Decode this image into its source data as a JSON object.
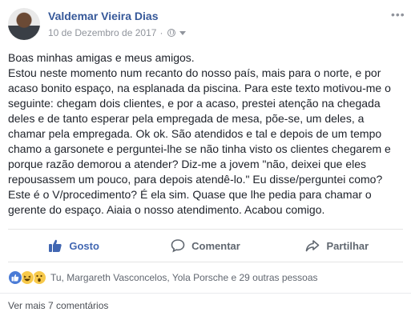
{
  "post": {
    "author": "Valdemar Vieira Dias",
    "date": "10 de Dezembro de 2017",
    "separator": "·",
    "more_icon": "ellipsis-icon",
    "privacy_icon": "globe-icon",
    "paragraphs": [
      "Boas minhas amigas e meus amigos.",
      "Estou neste momento num recanto do nosso país, mais para o norte, e por acaso bonito espaço, na esplanada da piscina. Para este texto motivou-me o seguinte: chegam dois clientes, e por a acaso, prestei atenção na chegada deles e de tanto esperar pela empregada de mesa, põe-se, um deles, a chamar pela empregada. Ok ok. São atendidos e tal e depois de um tempo chamo a garsonete e perguntei-lhe se não tinha visto os clientes chegarem e porque razão demorou a atender? Diz-me a jovem \"não, deixei que eles repousassem um pouco, para depois atendê-lo.\" Eu disse/perguntei como? Este é o V/procedimento? É ela sim. Quase que lhe pedia para chamar o gerente do espaço. Aiaia o nosso atendimento. Acabou comigo."
    ]
  },
  "actions": {
    "like": "Gosto",
    "comment": "Comentar",
    "share": "Partilhar"
  },
  "reactions": {
    "icons": [
      "like-icon",
      "haha-icon",
      "wow-icon"
    ],
    "summary": "Tu, Margareth Vasconcelos, Yola Porsche e 29 outras pessoas"
  },
  "comments": {
    "more_label": "Ver mais 7 comentários"
  },
  "colors": {
    "link_blue": "#365899",
    "like_blue": "#4267b2",
    "muted": "#90949c",
    "text": "#1d2129"
  }
}
